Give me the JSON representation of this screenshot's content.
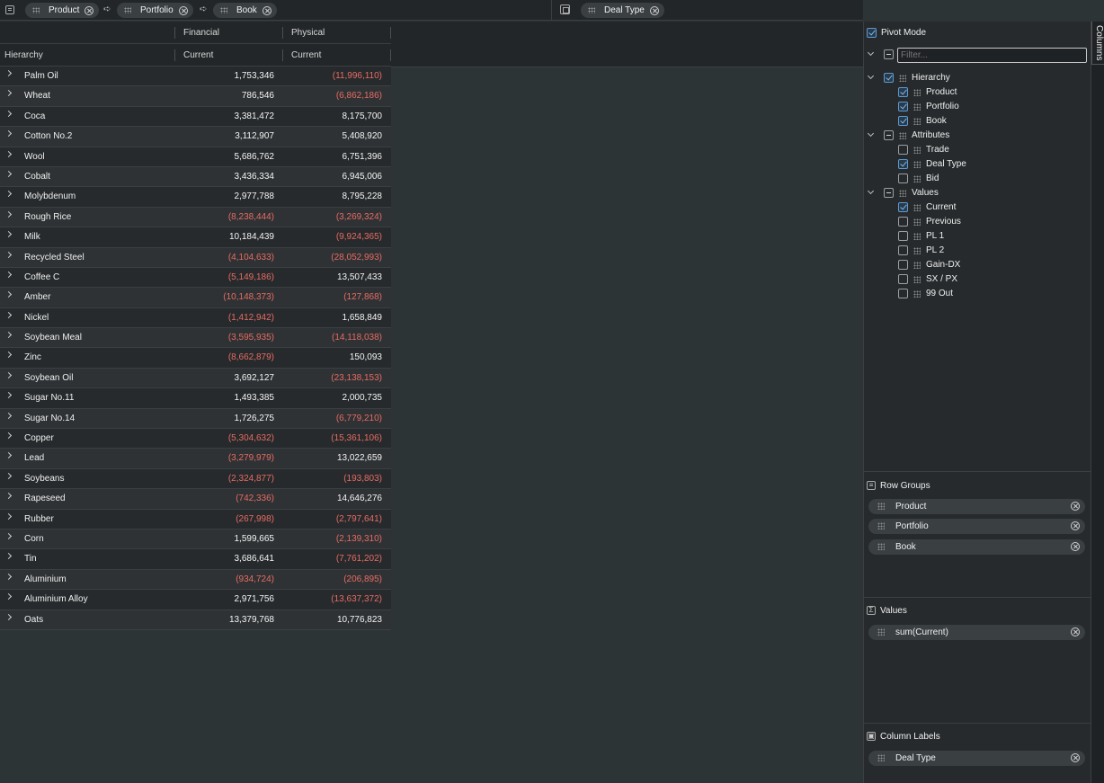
{
  "top_bar": {
    "row_groups": [
      "Product",
      "Portfolio",
      "Book"
    ],
    "column_groups": [
      "Deal Type"
    ]
  },
  "grid": {
    "header_groups": [
      "Financial",
      "Physical"
    ],
    "header_cols": [
      "Hierarchy",
      "Current",
      "Current"
    ],
    "rows": [
      {
        "name": "Palm Oil",
        "financial": "1,753,346",
        "physical": "(11,996,110)"
      },
      {
        "name": "Wheat",
        "financial": "786,546",
        "physical": "(6,862,186)"
      },
      {
        "name": "Coca",
        "financial": "3,381,472",
        "physical": "8,175,700"
      },
      {
        "name": "Cotton No.2",
        "financial": "3,112,907",
        "physical": "5,408,920"
      },
      {
        "name": "Wool",
        "financial": "5,686,762",
        "physical": "6,751,396"
      },
      {
        "name": "Cobalt",
        "financial": "3,436,334",
        "physical": "6,945,006"
      },
      {
        "name": "Molybdenum",
        "financial": "2,977,788",
        "physical": "8,795,228"
      },
      {
        "name": "Rough Rice",
        "financial": "(8,238,444)",
        "physical": "(3,269,324)"
      },
      {
        "name": "Milk",
        "financial": "10,184,439",
        "physical": "(9,924,365)"
      },
      {
        "name": "Recycled Steel",
        "financial": "(4,104,633)",
        "physical": "(28,052,993)"
      },
      {
        "name": "Coffee C",
        "financial": "(5,149,186)",
        "physical": "13,507,433"
      },
      {
        "name": "Amber",
        "financial": "(10,148,373)",
        "physical": "(127,868)"
      },
      {
        "name": "Nickel",
        "financial": "(1,412,942)",
        "physical": "1,658,849"
      },
      {
        "name": "Soybean Meal",
        "financial": "(3,595,935)",
        "physical": "(14,118,038)"
      },
      {
        "name": "Zinc",
        "financial": "(8,662,879)",
        "physical": "150,093"
      },
      {
        "name": "Soybean Oil",
        "financial": "3,692,127",
        "physical": "(23,138,153)"
      },
      {
        "name": "Sugar No.11",
        "financial": "1,493,385",
        "physical": "2,000,735"
      },
      {
        "name": "Sugar No.14",
        "financial": "1,726,275",
        "physical": "(6,779,210)"
      },
      {
        "name": "Copper",
        "financial": "(5,304,632)",
        "physical": "(15,361,106)"
      },
      {
        "name": "Lead",
        "financial": "(3,279,979)",
        "physical": "13,022,659"
      },
      {
        "name": "Soybeans",
        "financial": "(2,324,877)",
        "physical": "(193,803)"
      },
      {
        "name": "Rapeseed",
        "financial": "(742,336)",
        "physical": "14,646,276"
      },
      {
        "name": "Rubber",
        "financial": "(267,998)",
        "physical": "(2,797,641)"
      },
      {
        "name": "Corn",
        "financial": "1,599,665",
        "physical": "(2,139,310)"
      },
      {
        "name": "Tin",
        "financial": "3,686,641",
        "physical": "(7,761,202)"
      },
      {
        "name": "Aluminium",
        "financial": "(934,724)",
        "physical": "(206,895)"
      },
      {
        "name": "Aluminium Alloy",
        "financial": "2,971,756",
        "physical": "(13,637,372)"
      },
      {
        "name": "Oats",
        "financial": "13,379,768",
        "physical": "10,776,823"
      }
    ]
  },
  "side_panel": {
    "tab_label": "Columns",
    "pivot_mode_label": "Pivot Mode",
    "pivot_mode": true,
    "filter_placeholder": "Filter...",
    "tree": [
      {
        "label": "Hierarchy",
        "checked": "on",
        "children": [
          {
            "label": "Product",
            "checked": "on"
          },
          {
            "label": "Portfolio",
            "checked": "on"
          },
          {
            "label": "Book",
            "checked": "on"
          }
        ]
      },
      {
        "label": "Attributes",
        "checked": "ind",
        "children": [
          {
            "label": "Trade",
            "checked": "off"
          },
          {
            "label": "Deal Type",
            "checked": "on"
          },
          {
            "label": "Bid",
            "checked": "off"
          }
        ]
      },
      {
        "label": "Values",
        "checked": "ind",
        "children": [
          {
            "label": "Current",
            "checked": "on"
          },
          {
            "label": "Previous",
            "checked": "off"
          },
          {
            "label": "PL 1",
            "checked": "off"
          },
          {
            "label": "PL 2",
            "checked": "off"
          },
          {
            "label": "Gain-DX",
            "checked": "off"
          },
          {
            "label": "SX / PX",
            "checked": "off"
          },
          {
            "label": "99 Out",
            "checked": "off"
          }
        ]
      }
    ],
    "row_groups_title": "Row Groups",
    "row_groups": [
      "Product",
      "Portfolio",
      "Book"
    ],
    "values_title": "Values",
    "values": [
      "sum(Current)"
    ],
    "column_labels_title": "Column Labels",
    "column_labels": [
      "Deal Type"
    ]
  },
  "colors": {
    "negative": "#e86b63",
    "accent": "#5b9bd5"
  }
}
